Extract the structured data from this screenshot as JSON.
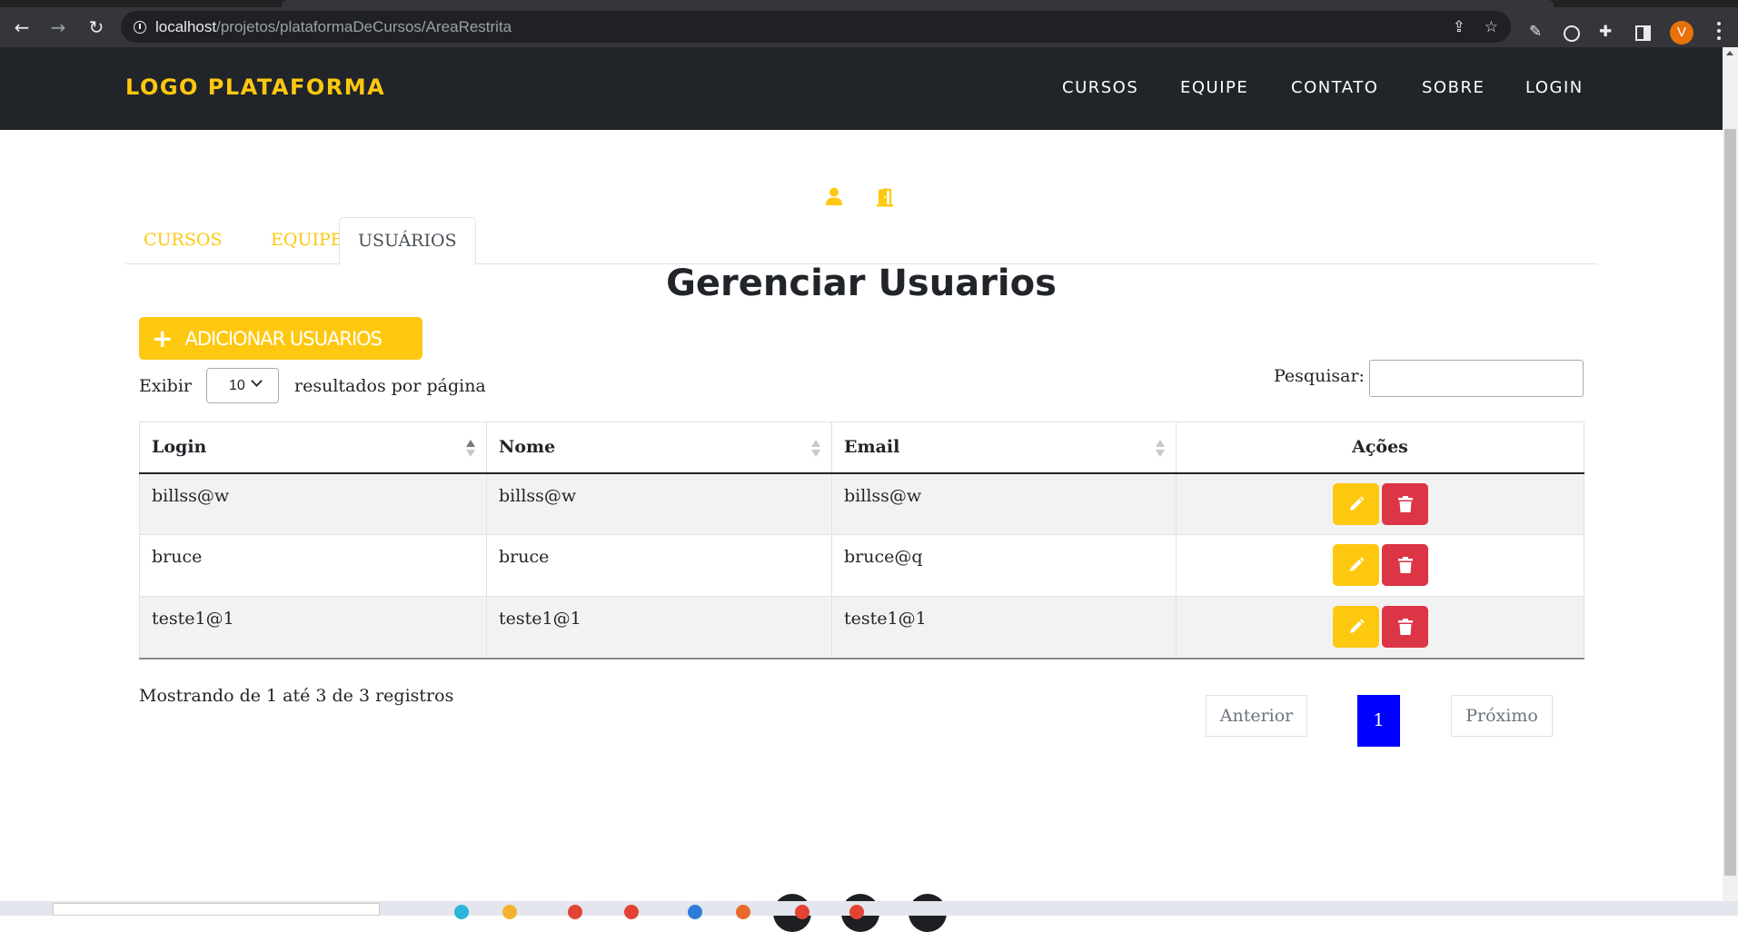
{
  "browser": {
    "url_host": "localhost",
    "url_path": "/projetos/plataformaDeCursos/AreaRestrita",
    "avatar_letter": "V"
  },
  "navbar": {
    "logo": "LOGO PLATAFORMA",
    "links": [
      "CURSOS",
      "EQUIPE",
      "CONTATO",
      "SOBRE",
      "LOGIN"
    ],
    "accent_color": "#fec810"
  },
  "tabs": [
    "CURSOS",
    "EQUIPE",
    "USUÁRIOS"
  ],
  "active_tab": "USUÁRIOS",
  "page_title": "Gerenciar Usuarios",
  "add_button_label": "ADICIONAR USUARIOS",
  "length": {
    "prefix": "Exibir",
    "value": "10",
    "suffix": "resultados por página"
  },
  "search": {
    "label": "Pesquisar:",
    "value": ""
  },
  "table": {
    "headers": [
      "Login",
      "Nome",
      "Email",
      "Ações"
    ],
    "sort_column": "Login",
    "rows": [
      {
        "login": "billss@w",
        "nome": "billss@w",
        "email": "billss@w"
      },
      {
        "login": "bruce",
        "nome": "bruce",
        "email": "bruce@q"
      },
      {
        "login": "teste1@1",
        "nome": "teste1@1",
        "email": "teste1@1"
      }
    ]
  },
  "footer": {
    "info": "Mostrando de 1 até 3 de 3 registros",
    "previous": "Anterior",
    "current_page": "1",
    "next": "Próximo"
  },
  "colors": {
    "edit": "#fec810",
    "delete": "#dc3545",
    "current_page": "#0000ff",
    "navbar_bg": "#212529"
  }
}
